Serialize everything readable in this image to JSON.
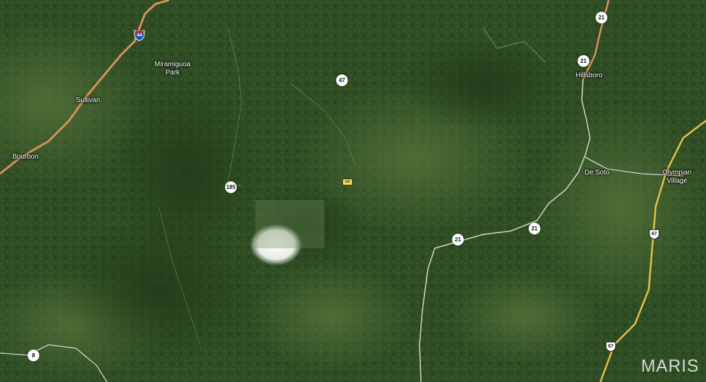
{
  "places": {
    "miramiguoa_line1": "Miramiguoa",
    "miramiguoa_line2": "Park",
    "sullivan": "Sullivan",
    "bourbon": "Bourbon",
    "hillsboro": "Hillsboro",
    "de_soto": "De Soto",
    "olympian_line1": "Olympian",
    "olympian_line2": "Village"
  },
  "routes": {
    "interstate_44": "44",
    "state_21_top": "21",
    "state_21_hillsboro": "21",
    "state_47": "47",
    "state_185": "185",
    "state_21_east": "21",
    "state_21_west": "21",
    "us_67_upper": "67",
    "us_67_lower": "67",
    "state_8": "8",
    "county_small": "AA"
  },
  "watermark": "MARIS",
  "colors": {
    "interstate_road": "#d9925a",
    "us_highway_road": "#e7c24a",
    "state_road": "#d8d8d8",
    "forest": "#2c4a22",
    "cloud": "#f1f1f1"
  }
}
